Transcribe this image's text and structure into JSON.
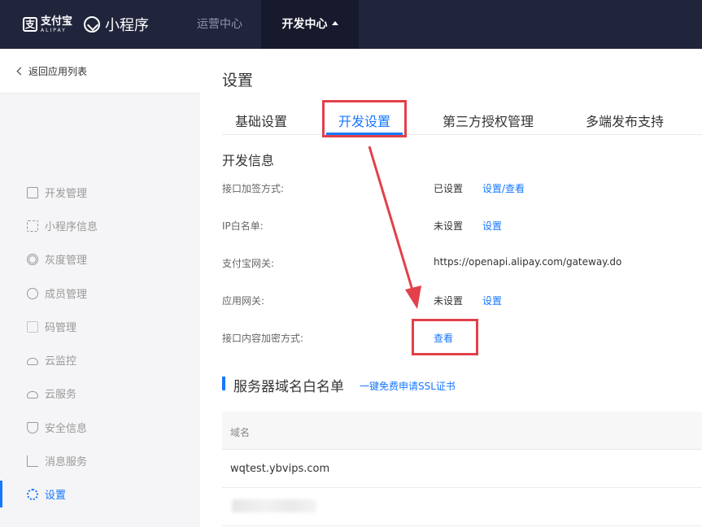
{
  "header": {
    "brand_cn": "支付宝",
    "brand_en": "ALIPAY",
    "product": "小程序",
    "nav": [
      {
        "label": "运营中心"
      },
      {
        "label": "开发中心"
      }
    ]
  },
  "sidebar": {
    "back_label": "返回应用列表",
    "items": [
      {
        "label": "开发管理",
        "icon": "code-icon"
      },
      {
        "label": "小程序信息",
        "icon": "apps-icon"
      },
      {
        "label": "灰度管理",
        "icon": "broadcast-icon"
      },
      {
        "label": "成员管理",
        "icon": "user-icon"
      },
      {
        "label": "码管理",
        "icon": "qrcode-icon"
      },
      {
        "label": "云监控",
        "icon": "cloud-icon"
      },
      {
        "label": "云服务",
        "icon": "cloud-service-icon"
      },
      {
        "label": "安全信息",
        "icon": "shield-icon"
      },
      {
        "label": "消息服务",
        "icon": "message-chart-icon"
      },
      {
        "label": "设置",
        "icon": "gear-icon",
        "active": true
      }
    ]
  },
  "main": {
    "title": "设置",
    "tabs": [
      {
        "label": "基础设置"
      },
      {
        "label": "开发设置",
        "active": true
      },
      {
        "label": "第三方授权管理"
      },
      {
        "label": "多端发布支持"
      }
    ],
    "dev_info": {
      "title": "开发信息",
      "rows": [
        {
          "label": "接口加签方式:",
          "value": "已设置",
          "link": "设置/查看"
        },
        {
          "label": "IP白名单:",
          "value": "未设置",
          "link": "设置"
        },
        {
          "label": "支付宝网关:",
          "value": "https://openapi.alipay.com/gateway.do",
          "link": ""
        },
        {
          "label": "应用网关:",
          "value": "未设置",
          "link": "设置"
        },
        {
          "label": "接口内容加密方式:",
          "value": "",
          "link": "查看"
        }
      ]
    },
    "whitelist": {
      "title": "服务器域名白名单",
      "link": "一键免费申请SSL证书",
      "column": "域名",
      "rows": [
        "wqtest.ybvips.com"
      ]
    }
  },
  "colors": {
    "topbar": "#21253b",
    "accent": "#1677ff",
    "highlight": "#e2404a"
  }
}
